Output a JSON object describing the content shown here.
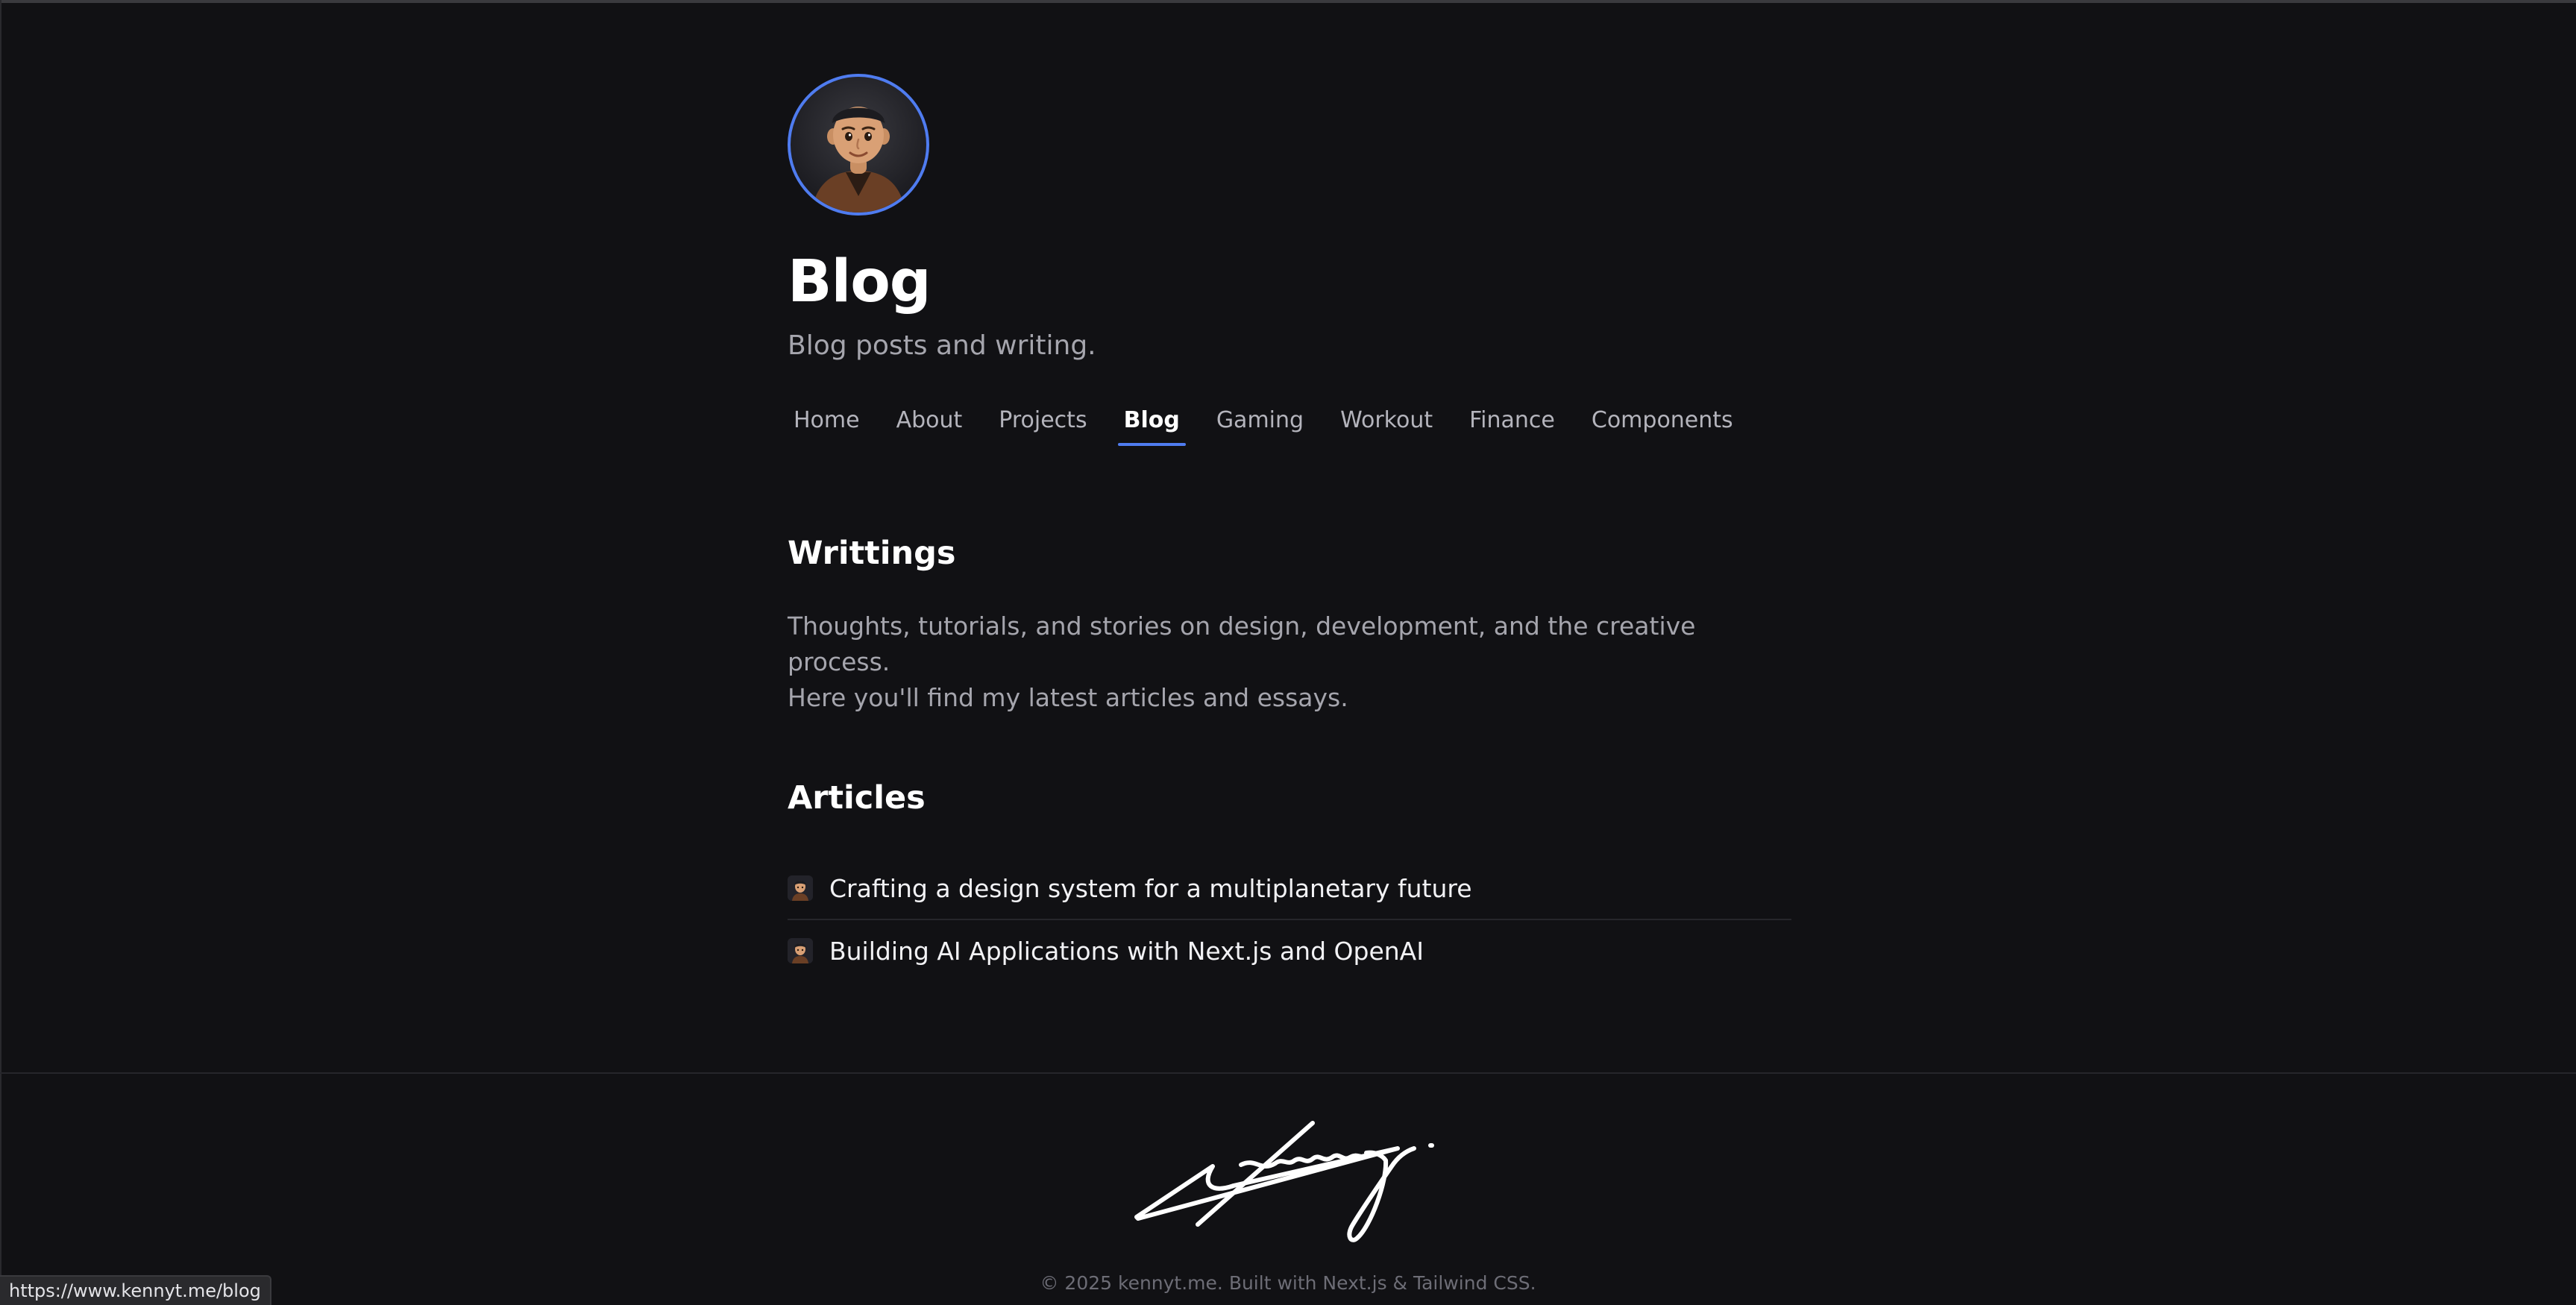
{
  "header": {
    "avatar_icon": "memoji-avatar",
    "title": "Blog",
    "subtitle": "Blog posts and writing."
  },
  "nav": {
    "items": [
      {
        "label": "Home",
        "active": false
      },
      {
        "label": "About",
        "active": false
      },
      {
        "label": "Projects",
        "active": false
      },
      {
        "label": "Blog",
        "active": true
      },
      {
        "label": "Gaming",
        "active": false
      },
      {
        "label": "Workout",
        "active": false
      },
      {
        "label": "Finance",
        "active": false
      },
      {
        "label": "Components",
        "active": false
      }
    ]
  },
  "writings": {
    "heading": "Writtings",
    "line1": "Thoughts, tutorials, and stories on design, development, and the creative process.",
    "line2": "Here you'll find my latest articles and essays."
  },
  "articles": {
    "heading": "Articles",
    "items": [
      {
        "title": "Crafting a design system for a multiplanetary future",
        "thumb_icon": "memoji-thumbnail"
      },
      {
        "title": "Building AI Applications with Next.js and OpenAI",
        "thumb_icon": "memoji-thumbnail"
      }
    ]
  },
  "footer": {
    "signature_icon": "kenny-signature",
    "text": "© 2025 kennyt.me. Built with Next.js & Tailwind CSS."
  },
  "status_bar": {
    "url": "https://www.kennyt.me/blog"
  },
  "colors": {
    "background": "#111114",
    "accent": "#4f7cf0",
    "text_primary": "#ffffff",
    "text_secondary": "#a5a5ad",
    "text_muted": "#6d6d76",
    "divider": "#26262b"
  }
}
